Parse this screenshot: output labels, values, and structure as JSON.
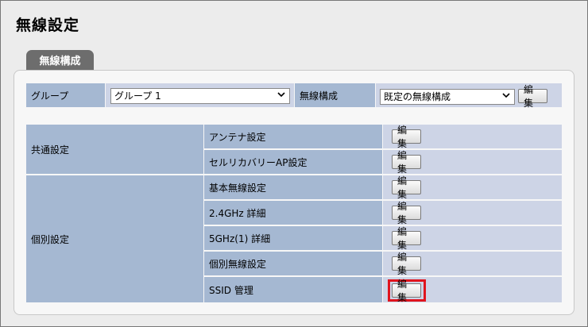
{
  "page": {
    "title": "無線設定"
  },
  "tab": {
    "label": "無線構成"
  },
  "top_row": {
    "group_label": "グループ",
    "group_select": "グループ 1",
    "config_label": "無線構成",
    "config_select": "既定の無線構成",
    "edit_label": "編集"
  },
  "sections": {
    "common": "共通設定",
    "individual": "個別設定"
  },
  "rows": [
    {
      "label": "アンテナ設定",
      "button": "編集"
    },
    {
      "label": "セルリカバリーAP設定",
      "button": "編集"
    },
    {
      "label": "基本無線設定",
      "button": "編集"
    },
    {
      "label": "2.4GHz 詳細",
      "button": "編集"
    },
    {
      "label": "5GHz(1) 詳細",
      "button": "編集"
    },
    {
      "label": "個別無線設定",
      "button": "編集"
    },
    {
      "label": "SSID 管理",
      "button": "編集",
      "highlighted": true
    }
  ],
  "colors": {
    "highlight": "#e0141e",
    "label_bg": "#a5b8d2",
    "value_bg": "#cdd4e6"
  }
}
